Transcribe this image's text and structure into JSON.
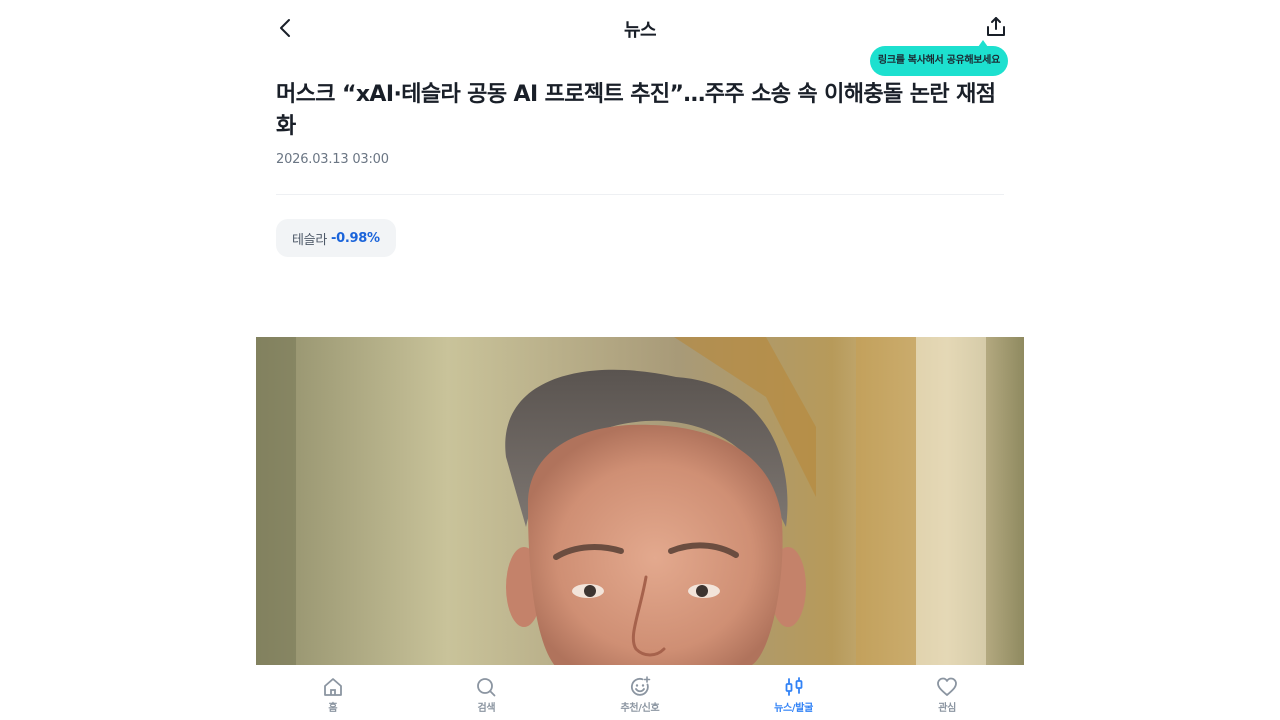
{
  "header": {
    "title": "뉴스",
    "tooltip": "링크를 복사해서 공유해보세요"
  },
  "article": {
    "title": "머스크 “xAI·테슬라 공동 AI 프로젝트 추진”…주주 소송 속 이해충돌 논란 재점화",
    "date": "2026.03.13 03:00"
  },
  "stock_chip": {
    "name": "테슬라",
    "change": "-0.98%"
  },
  "bottom_nav": {
    "items": [
      {
        "label": "홈",
        "icon": "home-icon"
      },
      {
        "label": "검색",
        "icon": "search-icon"
      },
      {
        "label": "추천/신호",
        "icon": "smile-sparkle-icon"
      },
      {
        "label": "뉴스/발굴",
        "icon": "candlestick-icon",
        "active": true
      },
      {
        "label": "관심",
        "icon": "heart-icon"
      }
    ]
  },
  "colors": {
    "accent": "#3182f6",
    "tooltip_bg": "#1de0cf",
    "negative_change": "#1b64da"
  }
}
